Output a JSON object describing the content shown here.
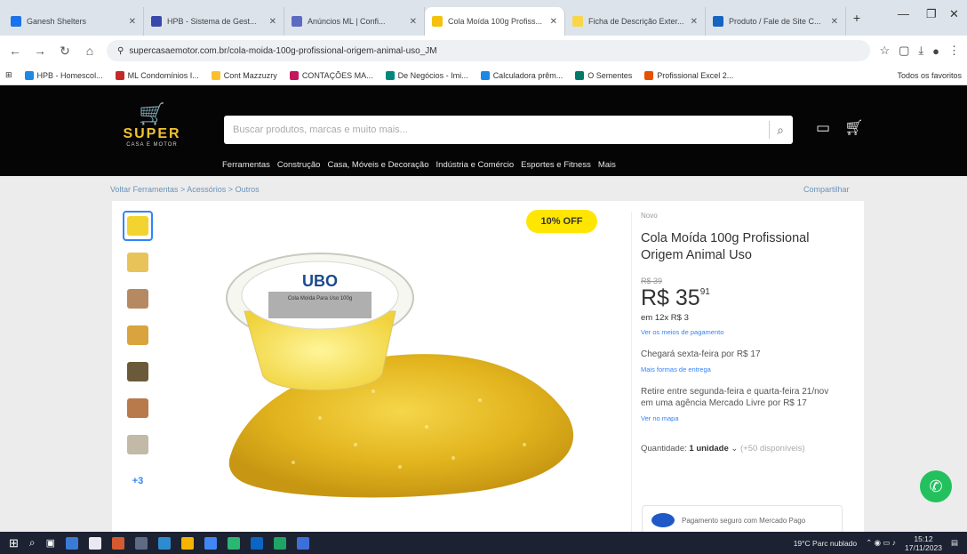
{
  "browser": {
    "tabs": [
      {
        "title": "Ganesh Shelters",
        "color": "#1a73e8",
        "active": false
      },
      {
        "title": "HPB - Sistema de Gest...",
        "color": "#3949ab",
        "active": false
      },
      {
        "title": "Anúncios ML | Confi...",
        "color": "#5c6bc0",
        "active": false
      },
      {
        "title": "Cola Moída 100g Profiss...",
        "color": "#f4c20d",
        "active": true
      },
      {
        "title": "Ficha de Descrição Exter...",
        "color": "#f9d648",
        "active": false
      },
      {
        "title": "Produto / Fale de Site C...",
        "color": "#1565c0",
        "active": false
      }
    ],
    "new_tab": "+",
    "url": "supercasaemotor.com.br/cola-moida-100g-profissional-origem-animal-uso_JM",
    "bookmarks": [
      {
        "label": "HPB - Homescol...",
        "color": "#1e88e5"
      },
      {
        "label": "ML Condomínios I...",
        "color": "#c62828"
      },
      {
        "label": "Cont Mazzuzry",
        "color": "#fbc02d"
      },
      {
        "label": "CONTAÇÕES MA...",
        "color": "#c2185b"
      },
      {
        "label": "De Negócios - Imi...",
        "color": "#00897b"
      },
      {
        "label": "Calculadora prêm...",
        "color": "#1e88e5"
      },
      {
        "label": "O Sementes",
        "color": "#00796b"
      },
      {
        "label": "Profissional Excel 2...",
        "color": "#e65100"
      }
    ],
    "bookmark_folder": "Todos os favoritos"
  },
  "header": {
    "logo_text": "SUPER",
    "logo_sub": "CASA E MOTOR",
    "search_placeholder": "Buscar produtos, marcas e muito mais...",
    "nav_items": [
      "Ferramentas",
      "Construção",
      "Casa, Móveis e Decoração",
      "Indústria e Comércio",
      "Esportes e Fitness",
      "Mais"
    ]
  },
  "breadcrumb": "Voltar   Ferramentas > Acessórios > Outros",
  "share_label": "Compartilhar",
  "product": {
    "discount_badge": "10% OFF",
    "condition": "Novo",
    "title": "Cola Moída 100g Profissional Origem Animal Uso",
    "old_price": "R$ 39",
    "price_main": "R$ 35",
    "price_cents": "91",
    "installments": "em 12x R$ 3",
    "installments_link": "Ver os meios de pagamento",
    "shipping_text": "Chegará sexta-feira por R$ 17",
    "shipping_link": "Mais formas de entrega",
    "shipping_alt": "Retire entre segunda-feira e quarta-feira 21/nov em uma agência Mercado Livre por R$ 17",
    "shipping_alt_link": "Ver no mapa",
    "quantity_label": "Quantidade:",
    "quantity_value": "1 unidade",
    "quantity_avail": "(+50 disponíveis)",
    "mp_text": "Pagamento seguro com Mercado Pago",
    "image_label": "UBO",
    "image_sub": "Cola Moída Para Uso 100g",
    "thumb_more": "+3",
    "thumbs": [
      "#f2d32f",
      "#e7c35a",
      "#b58a63",
      "#d9a43d",
      "#6b5a3a",
      "#b87a4b",
      "#c2b9a6"
    ]
  },
  "taskbar": {
    "tray_text": "19°C Parc nublado",
    "time": "15:12",
    "date": "17/11/2023"
  }
}
